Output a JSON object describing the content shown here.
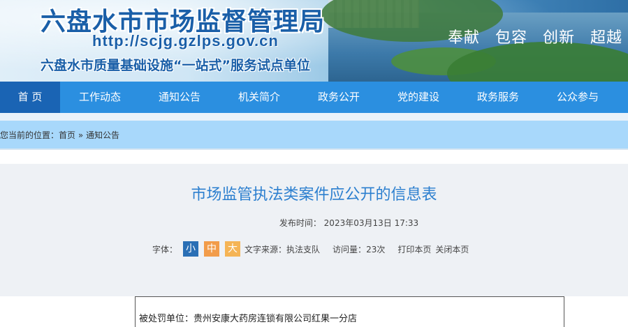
{
  "banner": {
    "title": "六盘水市市场监督管理局",
    "url": "http://scjg.gzlps.gov.cn",
    "subtitle": "六盘水市质量基础设施“一站式”服务试点单位",
    "slogan": [
      "奉献",
      "包容",
      "创新",
      "超越"
    ]
  },
  "nav": {
    "items": [
      {
        "label": "首 页"
      },
      {
        "label": "工作动态"
      },
      {
        "label": "通知公告"
      },
      {
        "label": "机关简介"
      },
      {
        "label": "政务公开"
      },
      {
        "label": "党的建设"
      },
      {
        "label": "政务服务"
      },
      {
        "label": "公众参与"
      }
    ]
  },
  "breadcrumb": {
    "prefix": "您当前的位置：",
    "home": "首页",
    "sep": "»",
    "current": "通知公告"
  },
  "article": {
    "title": "市场监管执法类案件应公开的信息表",
    "publish_label": "发布时间：",
    "publish_time": "2023年03月13日 17:33",
    "font_label": "字体：",
    "font_small": "小",
    "font_medium": "中",
    "font_large": "大",
    "source_label": "文字来源：",
    "source": "执法支队",
    "views_label": "访问量：",
    "views": "23次",
    "print": "打印本页",
    "close": "关闭本页"
  },
  "content": {
    "penalized_label": "被处罚单位：",
    "penalized_value": "贵州安康大药房连锁有限公司红果一分店"
  },
  "colors": {
    "nav_bg": "#2b8fe0",
    "nav_active": "#1a64b4",
    "breadcrumb_bg": "#a8d8fb",
    "title_color": "#2c7fcf"
  }
}
